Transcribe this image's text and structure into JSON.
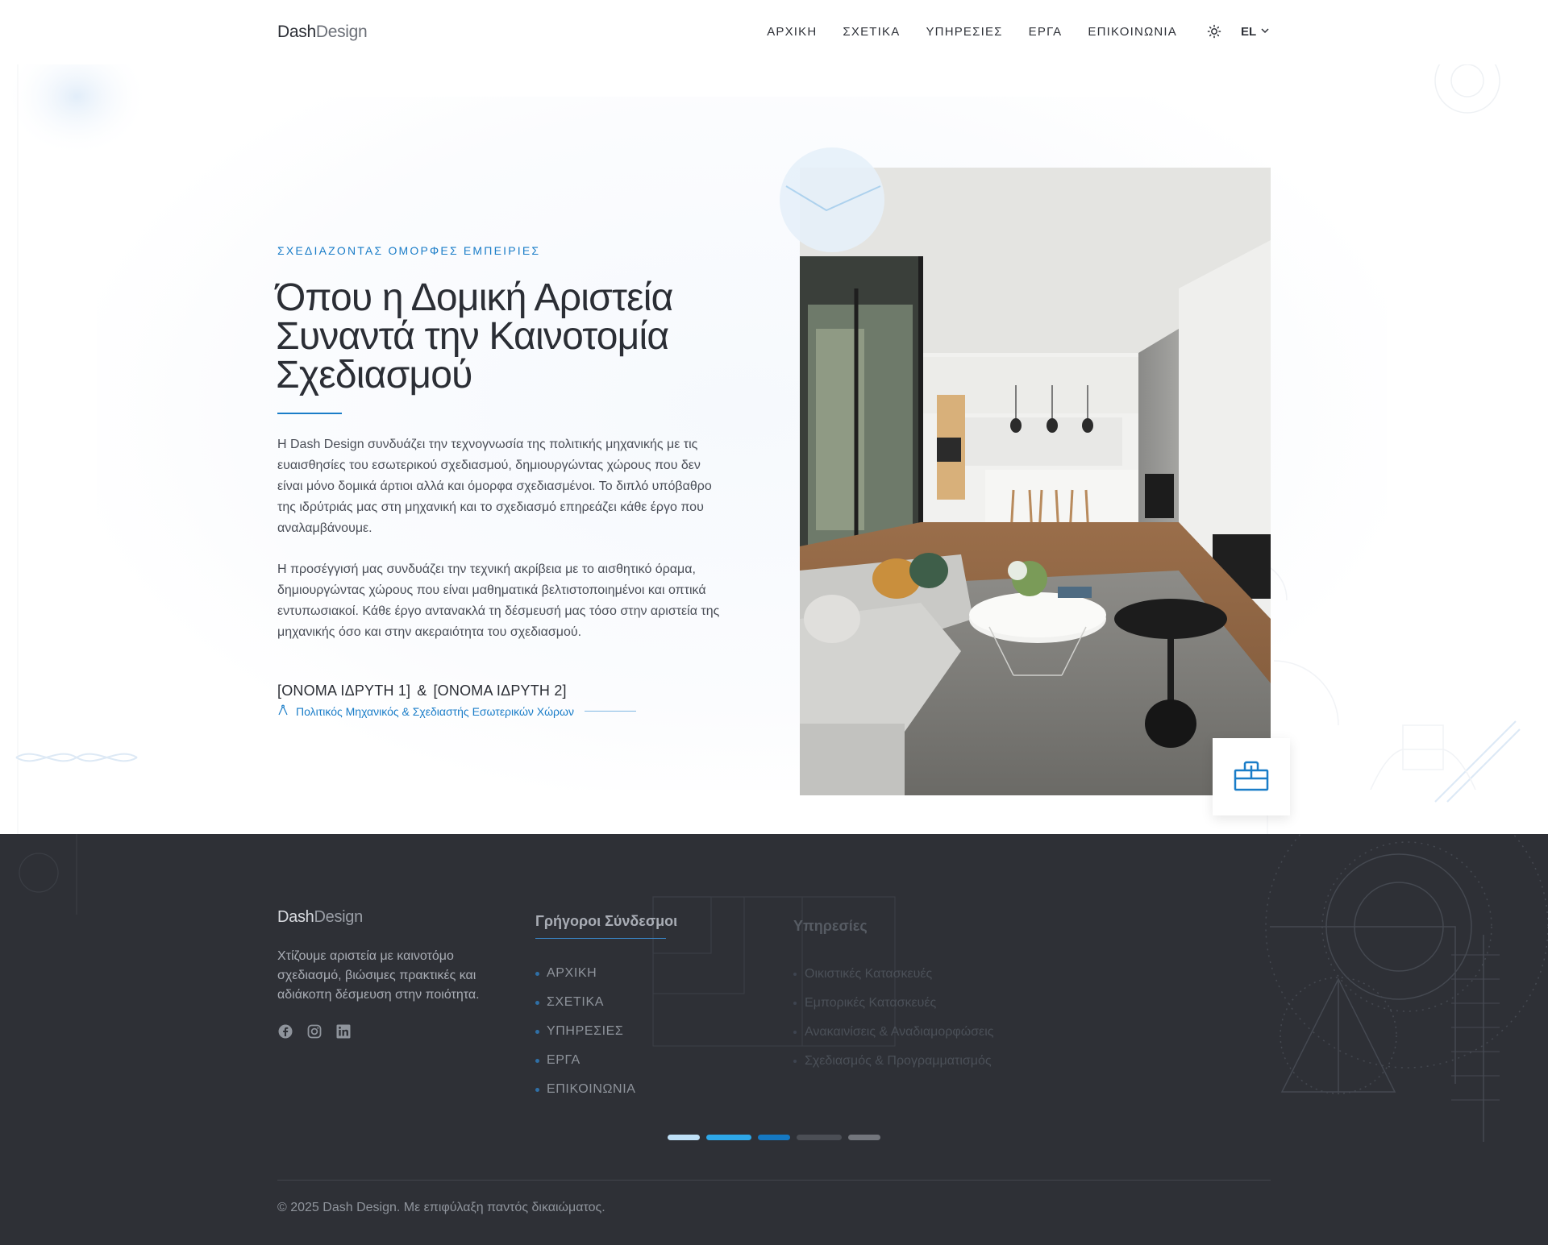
{
  "header": {
    "logo_part1": "Dash",
    "logo_part2": "Design",
    "nav": [
      "ΑΡΧΙΚΗ",
      "ΣΧΕΤΙΚΑ",
      "ΥΠΗΡΕΣΙΕΣ",
      "ΕΡΓΑ",
      "ΕΠΙΚΟΙΝΩΝΙΑ"
    ],
    "theme_icon": "sun-icon",
    "language": "EL",
    "language_icon": "chevron-down-icon"
  },
  "hero": {
    "eyebrow": "ΣΧΕΔΙΑΖΟΝΤΑΣ ΟΜΟΡΦΕΣ ΕΜΠΕΙΡΙΕΣ",
    "headline_line1": "Όπου η Δομική Αριστεία",
    "headline_line2": "Συναντά την Καινοτομία",
    "headline_line3": "Σχεδιασμού",
    "paragraph1": "Η Dash Design συνδυάζει την τεχνογνωσία της πολιτικής μηχανικής με τις ευαισθησίες του εσωτερικού σχεδιασμού, δημιουργώντας χώρους που δεν είναι μόνο δομικά άρτιοι αλλά και όμορφα σχεδιασμένοι. Το διπλό υπόβαθρο της ιδρύτριάς μας στη μηχανική και το σχεδιασμό επηρεάζει κάθε έργο που αναλαμβάνουμε.",
    "paragraph2": "Η προσέγγισή μας συνδυάζει την τεχνική ακρίβεια με το αισθητικό όραμα, δημιουργώντας χώρους που είναι μαθηματικά βελτιστοποιημένοι και οπτικά εντυπωσιακοί. Κάθε έργο αντανακλά τη δέσμευσή μας τόσο στην αριστεία της μηχανικής όσο και στην ακεραιότητα του σχεδιασμού.",
    "founder1": "[ΟΝΟΜΑ ΙΔΡΥΤΗ 1]",
    "founder_sep": "&",
    "founder2": "[ΟΝΟΜΑ ΙΔΡΥΤΗ 2]",
    "role": "Πολιτικός Μηχανικός & Σχεδιαστής Εσωτερικών Χώρων",
    "role_icon": "compass-icon",
    "photo_icon": "interior-living-room-photo",
    "badge_icon": "toolbox-icon"
  },
  "footer": {
    "logo_part1": "Dash",
    "logo_part2": "Design",
    "tagline": "Χτίζουμε αριστεία με καινοτόμο σχεδιασμό, βιώσιμες πρακτικές και αδιάκοπη δέσμευση στην ποιότητα.",
    "social_icons": [
      "facebook-icon",
      "instagram-icon",
      "linkedin-icon"
    ],
    "quick_links_title": "Γρήγοροι Σύνδεσμοι",
    "quick_links": [
      "ΑΡΧΙΚΗ",
      "ΣΧΕΤΙΚΑ",
      "ΥΠΗΡΕΣΙΕΣ",
      "ΕΡΓΑ",
      "ΕΠΙΚΟΙΝΩΝΙΑ"
    ],
    "services_title": "Υπηρεσίες",
    "services": [
      "Οικιστικές Κατασκευές",
      "Εμπορικές Κατασκευές",
      "Ανακαινίσεις & Αναδιαμορφώσεις",
      "Σχεδιασμός & Προγραμματισμός"
    ],
    "progress_colors": [
      "#bfe0f7",
      "#2ea7e8",
      "#1578c2",
      "#4b4e55",
      "#73767d"
    ],
    "copyright": "© 2025 Dash Design. Με επιφύλαξη παντός δικαιώματος."
  },
  "colors": {
    "accent": "#1a7dc8",
    "footer_bg": "#2e3036",
    "text_dark": "#2b2e35"
  }
}
